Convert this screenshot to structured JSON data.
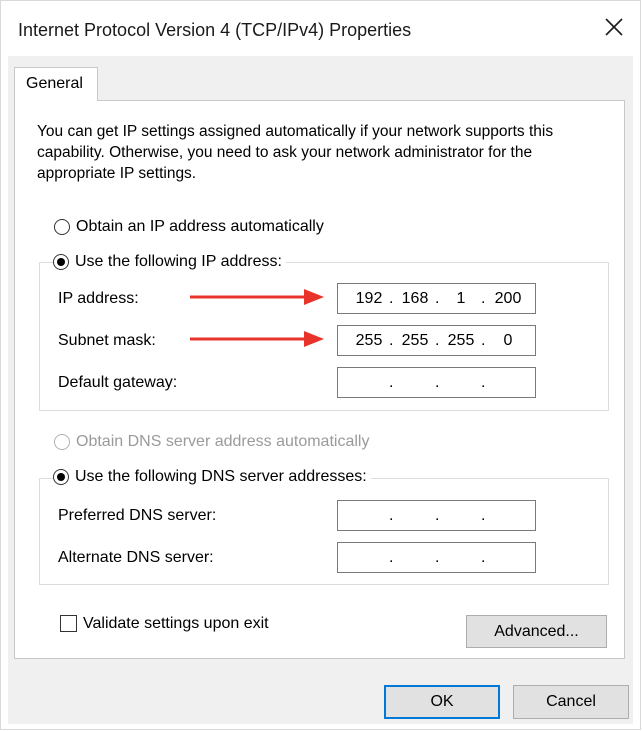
{
  "window": {
    "title": "Internet Protocol Version 4 (TCP/IPv4) Properties"
  },
  "tabs": [
    {
      "label": "General",
      "selected": true
    }
  ],
  "description": "You can get IP settings assigned automatically if your network supports this capability. Otherwise, you need to ask your network administrator for the appropriate IP settings.",
  "ip": {
    "auto_label": "Obtain an IP address automatically",
    "auto_selected": false,
    "manual_label": "Use the following IP address:",
    "manual_selected": true,
    "fields": {
      "ip_address": {
        "label": "IP address:",
        "octets": [
          "192",
          "168",
          "1",
          "200"
        ]
      },
      "subnet_mask": {
        "label": "Subnet mask:",
        "octets": [
          "255",
          "255",
          "255",
          "0"
        ]
      },
      "default_gateway": {
        "label": "Default gateway:",
        "octets": [
          "",
          "",
          "",
          ""
        ]
      }
    }
  },
  "dns": {
    "auto_label": "Obtain DNS server address automatically",
    "auto_enabled": false,
    "manual_label": "Use the following DNS server addresses:",
    "manual_selected": true,
    "fields": {
      "preferred": {
        "label": "Preferred DNS server:",
        "octets": [
          "",
          "",
          "",
          ""
        ]
      },
      "alternate": {
        "label": "Alternate DNS server:",
        "octets": [
          "",
          "",
          "",
          ""
        ]
      }
    }
  },
  "validate": {
    "label": "Validate settings upon exit",
    "checked": false
  },
  "buttons": {
    "advanced": "Advanced...",
    "ok": "OK",
    "cancel": "Cancel"
  },
  "annotations": {
    "arrow_color": "#e8332a",
    "arrow_targets": [
      "ip_address",
      "subnet_mask"
    ]
  },
  "colors": {
    "accent": "#0078d7",
    "client_bg": "#f0f0f0"
  },
  "icons": {
    "close": "close-icon"
  }
}
